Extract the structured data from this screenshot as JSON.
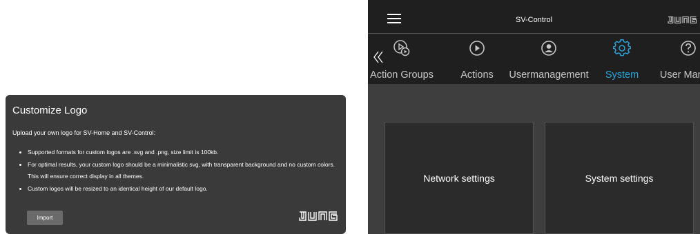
{
  "logo_card": {
    "title": "Customize Logo",
    "intro": "Upload your own logo for SV-Home and SV-Control:",
    "bullets": [
      "Supported formats for custom logos are .svg and .png, size limit is 100kb.",
      "For optimal results, your custom logo should be a minimalistic svg, with transparent background and no custom colors. This will ensure correct display in all themes.",
      "Custom logos will be resized to an identical height of our default logo."
    ],
    "import_label": "Import",
    "brand_logo": "JUNG"
  },
  "app": {
    "title": "SV-Control",
    "brand_logo": "JUNG",
    "menu_icon": "hamburger-menu-icon",
    "back_icon": "double-chevron-left-icon",
    "nav": [
      {
        "label": "Action Groups",
        "icon": "action-groups-icon"
      },
      {
        "label": "Actions",
        "icon": "play-circle-icon"
      },
      {
        "label": "Usermanagement",
        "icon": "user-circle-icon"
      },
      {
        "label": "System",
        "icon": "gear-icon",
        "active": true
      },
      {
        "label": "User Manual",
        "icon": "help-circle-icon"
      }
    ],
    "tiles": [
      {
        "label": "Network settings"
      },
      {
        "label": "System settings"
      }
    ]
  },
  "colors": {
    "card_bg": "#3a3a3a",
    "app_bg": "#3e3e3e",
    "bar_bg": "#1f1f1f",
    "tile_bg": "#2b2b2b",
    "accent": "#27a5de"
  }
}
